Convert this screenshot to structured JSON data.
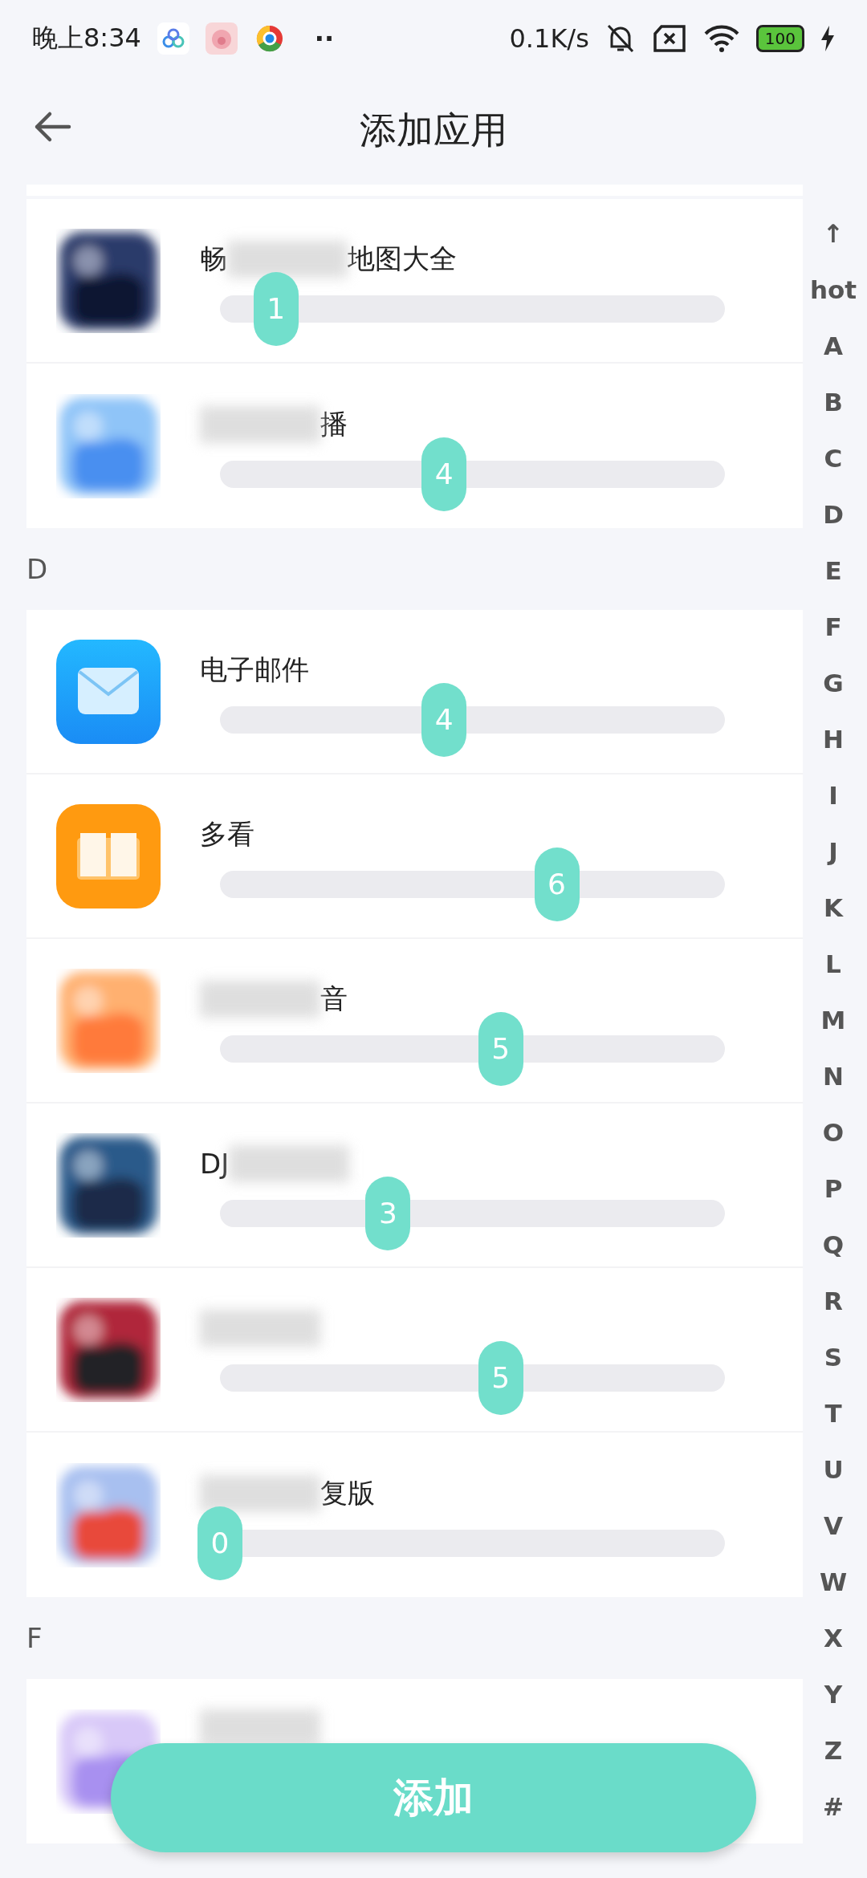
{
  "status_bar": {
    "time": "晚上8:34",
    "more": "··",
    "net_speed": "0.1K/s",
    "battery": "100"
  },
  "header": {
    "title": "添加应用"
  },
  "sections": [
    {
      "rows": [
        {
          "icon": {
            "kind": "picture"
          },
          "name_parts": [
            {
              "kind": "text",
              "text": "畅"
            },
            {
              "kind": "blur"
            },
            {
              "kind": "text",
              "text": "地图大全"
            }
          ],
          "value": "1",
          "level": 0.111
        },
        {
          "icon": {
            "kind": "picture"
          },
          "name_parts": [
            {
              "kind": "blur"
            },
            {
              "kind": "text",
              "text": "播"
            }
          ],
          "value": "4",
          "level": 0.444
        }
      ]
    },
    {
      "letter": "D",
      "rows": [
        {
          "icon": {
            "kind": "mail"
          },
          "name_parts": [
            {
              "kind": "text",
              "text": "电子邮件"
            }
          ],
          "value": "4",
          "level": 0.444
        },
        {
          "icon": {
            "kind": "book"
          },
          "name_parts": [
            {
              "kind": "text",
              "text": "多看"
            }
          ],
          "value": "6",
          "level": 0.667
        },
        {
          "icon": {
            "kind": "picture"
          },
          "name_parts": [
            {
              "kind": "blur"
            },
            {
              "kind": "text",
              "text": "音"
            }
          ],
          "value": "5",
          "level": 0.556
        },
        {
          "icon": {
            "kind": "picture"
          },
          "name_parts": [
            {
              "kind": "text",
              "text": "DJ"
            },
            {
              "kind": "blur"
            }
          ],
          "value": "3",
          "level": 0.333
        },
        {
          "icon": {
            "kind": "picture"
          },
          "name_parts": [
            {
              "kind": "blur"
            }
          ],
          "value": "5",
          "level": 0.556
        },
        {
          "icon": {
            "kind": "picture"
          },
          "name_parts": [
            {
              "kind": "blur"
            },
            {
              "kind": "text",
              "text": "复版"
            }
          ],
          "value": "0",
          "level": 0
        }
      ]
    },
    {
      "letter": "F",
      "rows": [
        {
          "icon": {
            "kind": "picture"
          },
          "name_parts": [
            {
              "kind": "blur"
            }
          ]
        }
      ]
    }
  ],
  "index_bar": [
    "↑",
    "hot",
    "A",
    "B",
    "C",
    "D",
    "E",
    "F",
    "G",
    "H",
    "I",
    "J",
    "K",
    "L",
    "M",
    "N",
    "O",
    "P",
    "Q",
    "R",
    "S",
    "T",
    "U",
    "V",
    "W",
    "X",
    "Y",
    "Z",
    "#"
  ],
  "add_button": {
    "label": "添加"
  }
}
